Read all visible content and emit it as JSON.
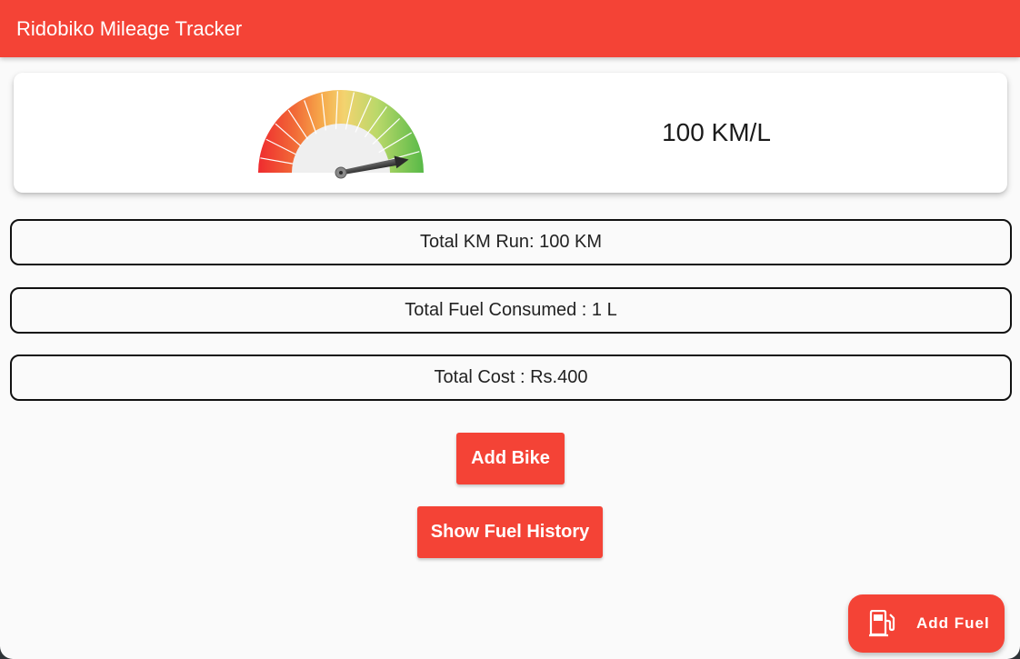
{
  "app": {
    "title": "Ridobiko Mileage Tracker"
  },
  "gauge": {
    "value_text": "100 KM/L",
    "level": 0.94,
    "icon": "speedometer-gauge-icon"
  },
  "stats": {
    "total_km": "Total KM Run: 100 KM",
    "total_fuel": "Total Fuel Consumed : 1 L",
    "total_cost": "Total Cost : Rs.400"
  },
  "buttons": {
    "add_bike": "Add Bike",
    "show_fuel_history": "Show Fuel History"
  },
  "fab": {
    "label": "Add Fuel",
    "icon": "fuel-pump-icon"
  },
  "colors": {
    "primary": "#f44336",
    "background": "#fafafa",
    "card": "#ffffff"
  }
}
